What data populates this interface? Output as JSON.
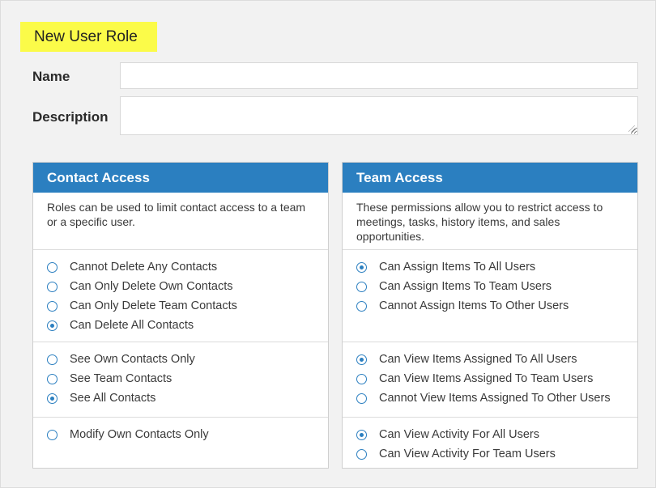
{
  "page": {
    "title": "New User Role"
  },
  "form": {
    "name_label": "Name",
    "name_value": "",
    "description_label": "Description",
    "description_value": ""
  },
  "colors": {
    "accent": "#2b7fc0",
    "title_highlight": "#fbfb49"
  },
  "contact_access": {
    "title": "Contact Access",
    "description": "Roles can be used to limit contact access to a team or a specific user.",
    "groups": [
      [
        {
          "label": "Cannot Delete Any Contacts",
          "checked": false
        },
        {
          "label": "Can Only Delete Own Contacts",
          "checked": false
        },
        {
          "label": "Can Only Delete Team Contacts",
          "checked": false
        },
        {
          "label": "Can Delete All Contacts",
          "checked": true
        }
      ],
      [
        {
          "label": "See Own Contacts Only",
          "checked": false
        },
        {
          "label": "See Team Contacts",
          "checked": false
        },
        {
          "label": "See All Contacts",
          "checked": true
        }
      ],
      [
        {
          "label": "Modify Own Contacts Only",
          "checked": false
        }
      ]
    ]
  },
  "team_access": {
    "title": "Team Access",
    "description": "These permissions allow you to restrict access to meetings, tasks, history items, and sales opportunities.",
    "groups": [
      [
        {
          "label": "Can Assign Items To All Users",
          "checked": true
        },
        {
          "label": "Can Assign Items To Team Users",
          "checked": false
        },
        {
          "label": "Cannot Assign Items To Other Users",
          "checked": false
        }
      ],
      [
        {
          "label": "Can View Items Assigned To All Users",
          "checked": true
        },
        {
          "label": "Can View Items Assigned To Team Users",
          "checked": false
        },
        {
          "label": "Cannot View Items Assigned To Other Users",
          "checked": false
        }
      ],
      [
        {
          "label": "Can View Activity For All Users",
          "checked": true
        },
        {
          "label": "Can View Activity For Team Users",
          "checked": false
        }
      ]
    ]
  }
}
